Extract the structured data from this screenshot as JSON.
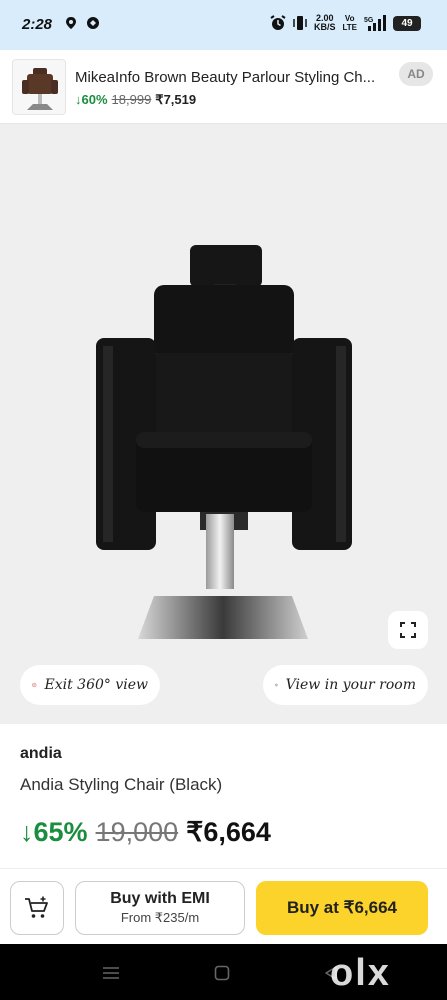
{
  "status_bar": {
    "time": "2:28",
    "speed_value": "2.00",
    "speed_unit": "KB/S",
    "network_top": "Vo",
    "network_bottom": "LTE",
    "signal_label": "5G",
    "battery": "49"
  },
  "ad": {
    "title": "MikeaInfo Brown Beauty Parlour Styling Ch...",
    "discount": "60%",
    "mrp": "18,999",
    "price": "₹7,519",
    "badge": "AD"
  },
  "viewer": {
    "exit_360_label": "Exit 360° view",
    "view_in_room_label": "View in your room"
  },
  "product": {
    "brand": "andia",
    "name": "Andia Styling Chair (Black)",
    "discount": "65%",
    "mrp": "19,000",
    "price": "₹6,664"
  },
  "actions": {
    "emi_label": "Buy with EMI",
    "emi_sub": "From ₹235/m",
    "buy_label": "Buy at ₹6,664"
  },
  "nav": {
    "watermark": "olx"
  },
  "colors": {
    "status_bar_bg": "#d9ecfb",
    "discount_green": "#1a8d3e",
    "buy_button_yellow": "#fcd32a",
    "image_bg": "#efefef"
  }
}
